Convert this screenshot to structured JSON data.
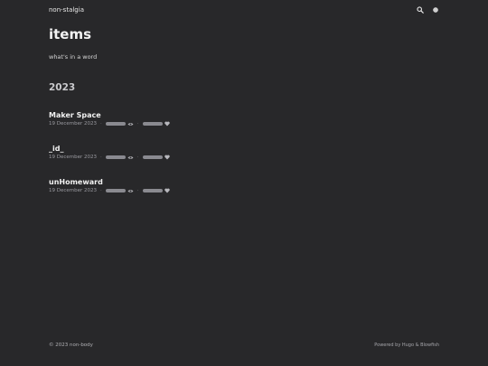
{
  "header": {
    "site_title": "non-stalgia",
    "icons": [
      "search-icon",
      "theme-toggle-icon"
    ]
  },
  "main": {
    "title": "items",
    "subtitle": "what's in a word",
    "year": "2023",
    "posts": [
      {
        "title": "Maker Space",
        "date": "19 December 2023"
      },
      {
        "title": "_id_",
        "date": "19 December 2023"
      },
      {
        "title": "unHomeward",
        "date": "19 December 2023"
      }
    ]
  },
  "footer": {
    "copyright": "© 2023 non-body",
    "powered": "Powered by Hugo & Blowfish"
  },
  "colors": {
    "background": "#28282a",
    "text": "#f2f2f2",
    "muted": "#9a9aa0",
    "pill": "#8a8a90"
  }
}
